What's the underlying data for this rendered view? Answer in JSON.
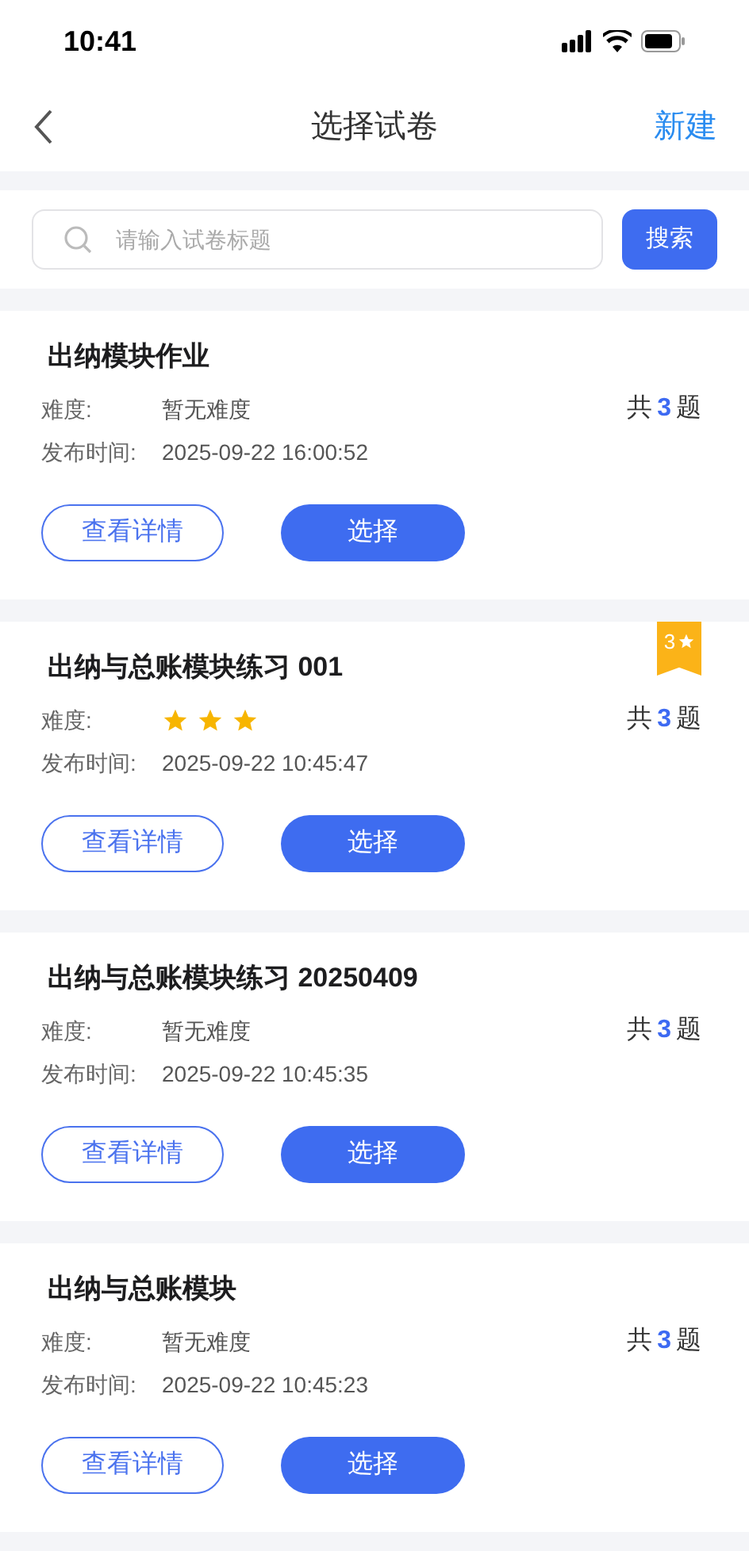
{
  "status_bar": {
    "time": "10:41"
  },
  "nav": {
    "title": "选择试卷",
    "action": "新建"
  },
  "search": {
    "placeholder": "请输入试卷标题",
    "button": "搜索"
  },
  "papers": [
    {
      "title": "出纳模块作业",
      "difficulty_label": "难度:",
      "difficulty": {
        "kind": "text",
        "text": "暂无难度"
      },
      "time_label": "发布时间:",
      "time": "2025-09-22 16:00:52",
      "count_prefix": "共",
      "count": "3",
      "count_suffix": "题",
      "detail_button": "查看详情",
      "select_button": "选择"
    },
    {
      "title": "出纳与总账模块练习 001",
      "badge": "3",
      "difficulty_label": "难度:",
      "difficulty": {
        "kind": "stars",
        "stars": 3
      },
      "time_label": "发布时间:",
      "time": "2025-09-22 10:45:47",
      "count_prefix": "共",
      "count": "3",
      "count_suffix": "题",
      "detail_button": "查看详情",
      "select_button": "选择"
    },
    {
      "title": "出纳与总账模块练习 20250409",
      "difficulty_label": "难度:",
      "difficulty": {
        "kind": "text",
        "text": "暂无难度"
      },
      "time_label": "发布时间:",
      "time": "2025-09-22 10:45:35",
      "count_prefix": "共",
      "count": "3",
      "count_suffix": "题",
      "detail_button": "查看详情",
      "select_button": "选择"
    },
    {
      "title": "出纳与总账模块",
      "difficulty_label": "难度:",
      "difficulty": {
        "kind": "text",
        "text": "暂无难度"
      },
      "time_label": "发布时间:",
      "time": "2025-09-22 10:45:23",
      "count_prefix": "共",
      "count": "3",
      "count_suffix": "题",
      "detail_button": "查看详情",
      "select_button": "选择"
    }
  ]
}
